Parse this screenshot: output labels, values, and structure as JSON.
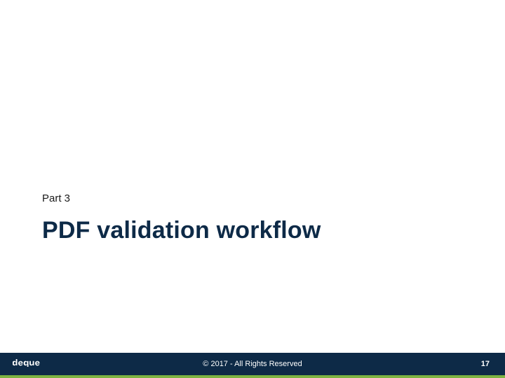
{
  "content": {
    "part_label": "Part 3",
    "title": "PDF validation workflow"
  },
  "footer": {
    "copyright": "© 2017 - All Rights Reserved",
    "page_number": "17",
    "brand_name": "deque"
  },
  "colors": {
    "footer_bg": "#0d2a47",
    "accent": "#7cb342",
    "title_color": "#0d2a47"
  }
}
